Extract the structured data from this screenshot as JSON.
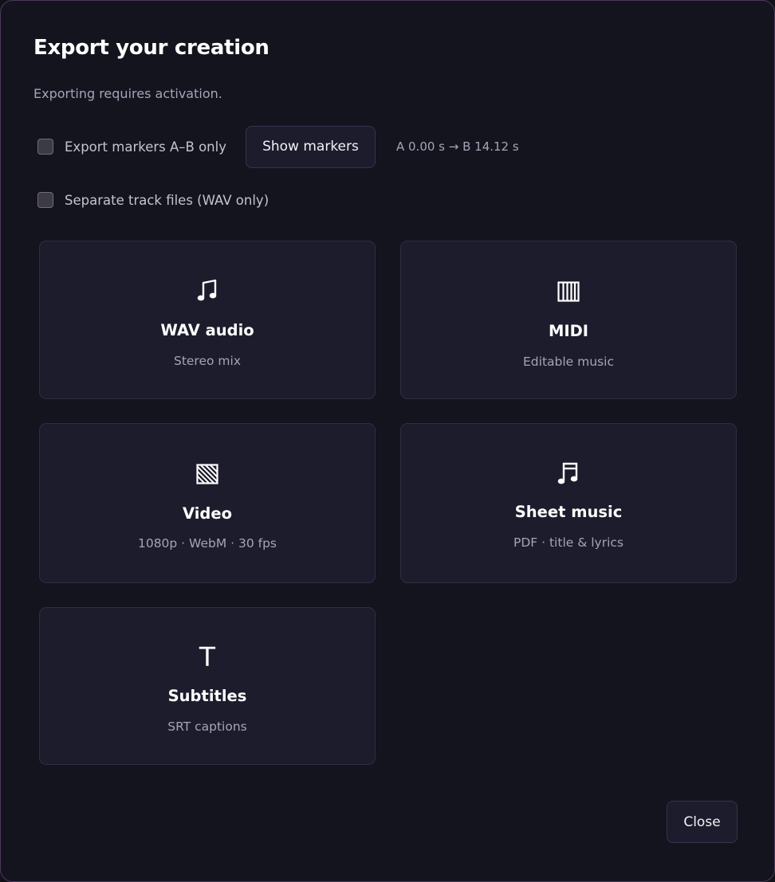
{
  "dialog": {
    "title": "Export your creation",
    "subtitle": "Exporting requires activation."
  },
  "options": {
    "export_markers_label": "Export markers A–B only",
    "export_markers_checked": false,
    "show_markers_button": "Show markers",
    "marker_range": "A 0.00 s → B 14.12 s",
    "separate_tracks_label": "Separate track files (WAV only)",
    "separate_tracks_checked": false
  },
  "cards": [
    {
      "icon": "music-note-icon",
      "title": "WAV audio",
      "description": "Stereo mix"
    },
    {
      "icon": "piano-keys-icon",
      "title": "MIDI",
      "description": "Editable music"
    },
    {
      "icon": "video-hatch-icon",
      "title": "Video",
      "description": "1080p · WebM · 30 fps"
    },
    {
      "icon": "beamed-notes-icon",
      "title": "Sheet music",
      "description": "PDF · title & lyrics"
    },
    {
      "icon": "text-t-icon",
      "icon_glyph": "T",
      "title": "Subtitles",
      "description": "SRT captions"
    }
  ],
  "footer": {
    "close_button": "Close"
  }
}
